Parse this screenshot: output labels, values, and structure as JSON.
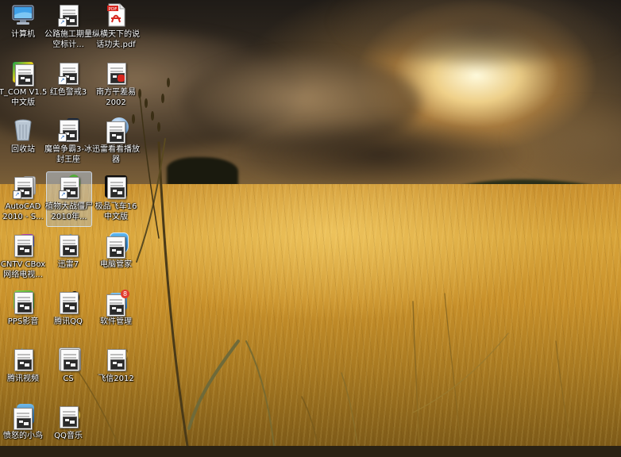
{
  "desktop": {
    "icons": [
      {
        "label": "计算机",
        "icon": "computer-icon"
      },
      {
        "label": "公路施工期量空标计...",
        "icon": "document-icon"
      },
      {
        "label": "纵横天下的说话功夫.pdf",
        "icon": "pdf-icon"
      },
      {
        "label": "T_COM V1.5 中文版",
        "icon": "app-icon"
      },
      {
        "label": "红色警戒3",
        "icon": "game-icon"
      },
      {
        "label": "南方平差易2002",
        "icon": "app-icon"
      },
      {
        "label": "回收站",
        "icon": "recycle-bin-icon"
      },
      {
        "label": "魔兽争霸3-冰封王座",
        "icon": "game-icon"
      },
      {
        "label": "迅雷看看播放器",
        "icon": "player-icon"
      },
      {
        "label": "AutoCAD 2010 - S...",
        "icon": "autocad-icon"
      },
      {
        "label": "植物大战僵尸2010年...",
        "icon": "game-icon"
      },
      {
        "label": "极品飞车16 中文版",
        "icon": "game-icon"
      },
      {
        "label": "CNTV CBox 网络电视...",
        "icon": "tv-icon"
      },
      {
        "label": "迅雷7",
        "icon": "thunder-icon"
      },
      {
        "label": "电脑管家",
        "icon": "shield-icon"
      },
      {
        "label": "PPS影音",
        "icon": "player-icon"
      },
      {
        "label": "腾讯QQ",
        "icon": "qq-icon"
      },
      {
        "label": "软件管理",
        "icon": "software-manager-icon"
      },
      {
        "label": "腾讯视频",
        "icon": "video-icon"
      },
      {
        "label": "CS",
        "icon": "game-icon"
      },
      {
        "label": "飞信2012",
        "icon": "fetion-icon"
      },
      {
        "label": "愤怒的小鸟",
        "icon": "game-icon"
      },
      {
        "label": "QQ音乐",
        "icon": "music-icon"
      }
    ]
  },
  "icon_badges": {
    "pdf_tag": "PDF",
    "software_manager_count": "8"
  },
  "colors": {
    "label_text": "#ffffff",
    "selection": "#b4d2ff",
    "pdf_red": "#d7261e",
    "qq_blue": "#2f8ee0"
  }
}
